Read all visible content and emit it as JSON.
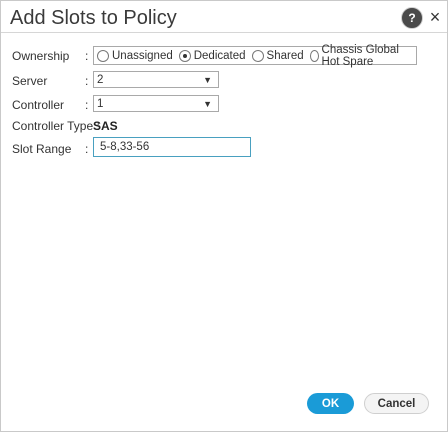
{
  "dialog": {
    "title": "Add Slots to Policy",
    "help_glyph": "?",
    "close_glyph": "×"
  },
  "form": {
    "ownership": {
      "label": "Ownership",
      "options": [
        "Unassigned",
        "Dedicated",
        "Shared",
        "Chassis Global Hot Spare"
      ],
      "selected": "Dedicated"
    },
    "server": {
      "label": "Server",
      "value": "2"
    },
    "controller": {
      "label": "Controller",
      "value": "1"
    },
    "controller_type": {
      "label": "Controller Type",
      "colon": ":",
      "value": "SAS"
    },
    "slot_range": {
      "label": "Slot Range",
      "value": "5-8,33-56"
    }
  },
  "buttons": {
    "ok": "OK",
    "cancel": "Cancel"
  },
  "colors": {
    "accent": "#1a9bd7",
    "input_focus_border": "#49a0c0"
  }
}
